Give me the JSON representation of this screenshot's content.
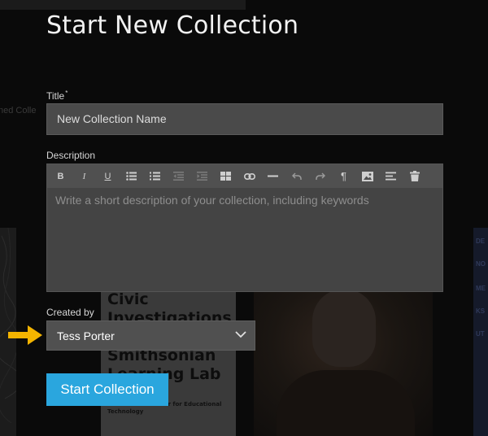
{
  "background": {
    "side_text": "ned Colle",
    "poster_text": [
      "Civic",
      "Investigations",
      "",
      "Smithsonian",
      "Learning Lab"
    ],
    "poster_subtext": "Smithsonian Center for Educational Technology",
    "right_text": [
      "DE",
      "NO",
      "ME",
      "KS",
      "UT"
    ]
  },
  "modal": {
    "title": "Start New Collection",
    "title_field": {
      "label": "Title",
      "required_mark": "*",
      "placeholder": "New Collection Name"
    },
    "description": {
      "label": "Description",
      "toolbar": [
        "bold-icon",
        "italic-icon",
        "underline-icon",
        "bullet-list-icon",
        "numbered-list-icon",
        "outdent-icon",
        "indent-icon",
        "table-icon",
        "link-icon",
        "horizontal-rule-icon",
        "undo-icon",
        "redo-icon",
        "paragraph-icon",
        "image-icon",
        "align-icon",
        "trash-icon"
      ],
      "placeholder": "Write a short description of your collection, including keywords"
    },
    "created_by": {
      "label": "Created by",
      "value": "Tess Porter"
    },
    "submit_label": "Start Collection"
  },
  "colors": {
    "accent": "#2aa6de",
    "arrow": "#f4b400",
    "field_bg": "#4a4a4a"
  }
}
